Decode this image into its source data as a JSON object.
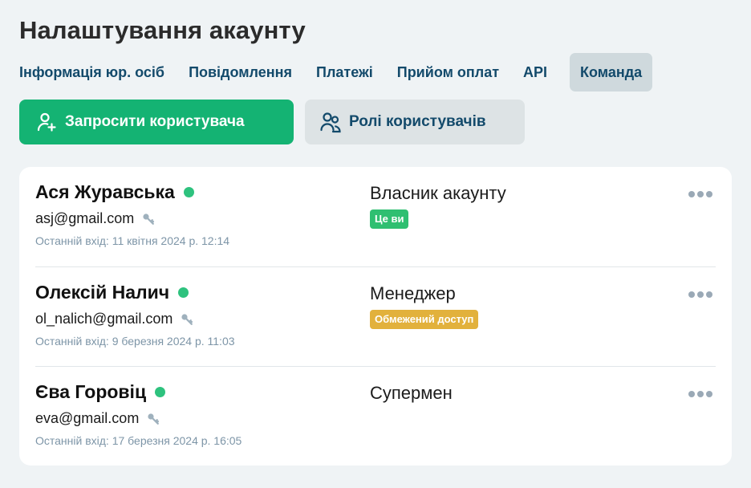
{
  "page_title": "Налаштування акаунту",
  "tabs": [
    {
      "label": "Інформація юр. осіб",
      "active": false
    },
    {
      "label": "Повідомлення",
      "active": false
    },
    {
      "label": "Платежі",
      "active": false
    },
    {
      "label": "Прийом оплат",
      "active": false
    },
    {
      "label": "API",
      "active": false
    },
    {
      "label": "Команда",
      "active": true
    }
  ],
  "actions": {
    "invite_label": "Запросити користувача",
    "roles_label": "Ролі користувачів"
  },
  "users": [
    {
      "name": "Ася Журавська",
      "email": "asj@gmail.com",
      "last_login": "Останній вхід: 11 квітня 2024 р. 12:14",
      "role": "Власник акаунту",
      "badge": "Це ви",
      "badge_color": "#2fbf71",
      "online": true
    },
    {
      "name": "Олексій Налич",
      "email": "ol_nalich@gmail.com",
      "last_login": "Останній вхід: 9 березня 2024 р. 11:03",
      "role": "Менеджер",
      "badge": "Обмежений доступ",
      "badge_color": "#e2b13c",
      "online": true
    },
    {
      "name": "Єва Горовіц",
      "email": "eva@gmail.com",
      "last_login": "Останній вхід: 17 березня 2024 р. 16:05",
      "role": "Супермен",
      "badge": "",
      "online": true
    }
  ],
  "colors": {
    "accent": "#14b373",
    "nav_text": "#134a6b",
    "online": "#2ec27e"
  }
}
